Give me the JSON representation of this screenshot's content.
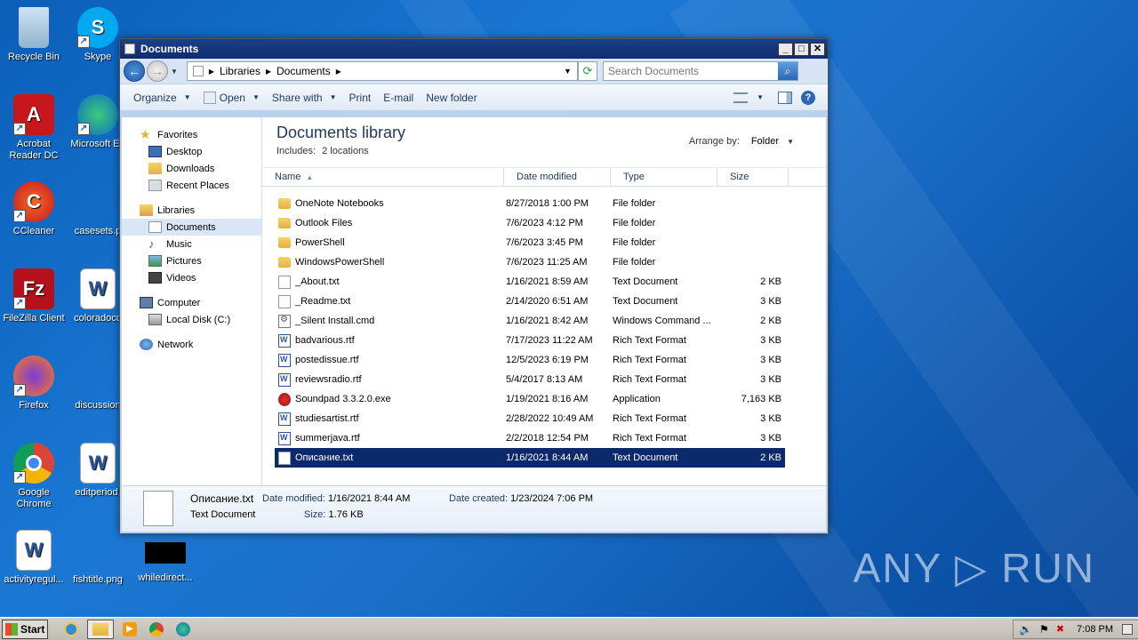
{
  "desktop": {
    "icons": [
      {
        "label": "Recycle Bin"
      },
      {
        "label": "Skype"
      },
      {
        "label": "Acrobat Reader DC"
      },
      {
        "label": "Microsoft Ed"
      },
      {
        "label": "CCleaner"
      },
      {
        "label": "casesets.p"
      },
      {
        "label": "FileZilla Client"
      },
      {
        "label": "coloradoco"
      },
      {
        "label": "Firefox"
      },
      {
        "label": "discussion"
      },
      {
        "label": "Google Chrome"
      },
      {
        "label": "editperiod."
      },
      {
        "label": "activityregul..."
      },
      {
        "label": "fishtitle.png"
      },
      {
        "label": "whiledirect..."
      }
    ],
    "watermark": "ANY ▷ RUN"
  },
  "window": {
    "title": "Documents",
    "controls": {
      "minimize": "_",
      "maximize": "□",
      "close": "✕"
    },
    "address": {
      "crumbs": [
        "Libraries",
        "Documents"
      ]
    },
    "search": {
      "placeholder": "Search Documents"
    },
    "toolbar": {
      "organize": "Organize",
      "open": "Open",
      "share_with": "Share with",
      "print": "Print",
      "email": "E-mail",
      "new_folder": "New folder"
    },
    "nav": {
      "favorites": "Favorites",
      "desktop": "Desktop",
      "downloads": "Downloads",
      "recent": "Recent Places",
      "libraries": "Libraries",
      "documents": "Documents",
      "music": "Music",
      "pictures": "Pictures",
      "videos": "Videos",
      "computer": "Computer",
      "local_disk": "Local Disk (C:)",
      "network": "Network"
    },
    "library": {
      "title": "Documents library",
      "includes": "Includes:",
      "locations": "2 locations",
      "arrange_label": "Arrange by:",
      "arrange_value": "Folder"
    },
    "columns": {
      "name": "Name",
      "date": "Date modified",
      "type": "Type",
      "size": "Size"
    },
    "files": [
      {
        "name": "OneNote Notebooks",
        "date": "8/27/2018 1:00 PM",
        "type": "File folder",
        "size": "",
        "icon": "folder-icon"
      },
      {
        "name": "Outlook Files",
        "date": "7/6/2023 4:12 PM",
        "type": "File folder",
        "size": "",
        "icon": "folder-icon"
      },
      {
        "name": "PowerShell",
        "date": "7/6/2023 3:45 PM",
        "type": "File folder",
        "size": "",
        "icon": "folder-icon"
      },
      {
        "name": "WindowsPowerShell",
        "date": "7/6/2023 11:25 AM",
        "type": "File folder",
        "size": "",
        "icon": "folder-icon"
      },
      {
        "name": "_About.txt",
        "date": "1/16/2021 8:59 AM",
        "type": "Text Document",
        "size": "2 KB",
        "icon": "text-file-icon"
      },
      {
        "name": "_Readme.txt",
        "date": "2/14/2020 6:51 AM",
        "type": "Text Document",
        "size": "3 KB",
        "icon": "text-file-icon"
      },
      {
        "name": "_Silent Install.cmd",
        "date": "1/16/2021 8:42 AM",
        "type": "Windows Command ...",
        "size": "2 KB",
        "icon": "cmd-file-icon"
      },
      {
        "name": "badvarious.rtf",
        "date": "7/17/2023 11:22 AM",
        "type": "Rich Text Format",
        "size": "3 KB",
        "icon": "rtf-file-icon"
      },
      {
        "name": "postedissue.rtf",
        "date": "12/5/2023 6:19 PM",
        "type": "Rich Text Format",
        "size": "3 KB",
        "icon": "rtf-file-icon"
      },
      {
        "name": "reviewsradio.rtf",
        "date": "5/4/2017 8:13 AM",
        "type": "Rich Text Format",
        "size": "3 KB",
        "icon": "rtf-file-icon"
      },
      {
        "name": "Soundpad 3.3.2.0.exe",
        "date": "1/19/2021 8:16 AM",
        "type": "Application",
        "size": "7,163 KB",
        "icon": "app-icon"
      },
      {
        "name": "studiesartist.rtf",
        "date": "2/28/2022 10:49 AM",
        "type": "Rich Text Format",
        "size": "3 KB",
        "icon": "rtf-file-icon"
      },
      {
        "name": "summerjava.rtf",
        "date": "2/2/2018 12:54 PM",
        "type": "Rich Text Format",
        "size": "3 KB",
        "icon": "rtf-file-icon"
      },
      {
        "name": "Описание.txt",
        "date": "1/16/2021 8:44 AM",
        "type": "Text Document",
        "size": "2 KB",
        "icon": "text-file-icon",
        "selected": true
      }
    ],
    "details": {
      "filename": "Описание.txt",
      "filetype": "Text Document",
      "date_modified_label": "Date modified:",
      "date_modified": "1/16/2021 8:44 AM",
      "size_label": "Size:",
      "size": "1.76 KB",
      "date_created_label": "Date created:",
      "date_created": "1/23/2024 7:06 PM"
    }
  },
  "taskbar": {
    "start": "Start",
    "clock": "7:08 PM"
  },
  "colors": {
    "selection": "#0c2a6b",
    "titlebar": "#1b3f86",
    "desktop": "#1a78d4"
  }
}
